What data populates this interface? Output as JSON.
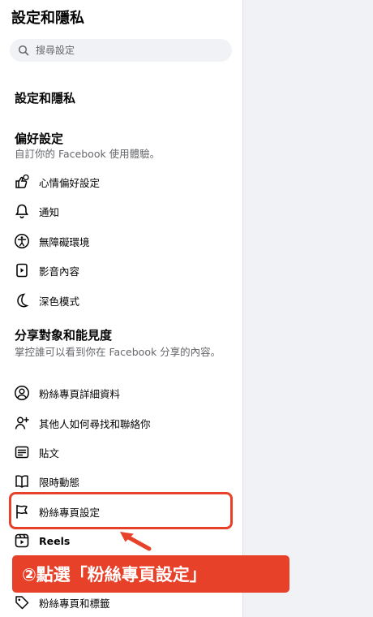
{
  "page_title": "設定和隱私",
  "search": {
    "placeholder": "搜尋設定"
  },
  "section_heading": "設定和隱私",
  "preferences": {
    "title": "偏好設定",
    "description": "自訂你的 Facebook 使用體驗。",
    "items": [
      {
        "label": "心情偏好設定",
        "icon": "reaction-preferences-icon"
      },
      {
        "label": "通知",
        "icon": "bell-icon"
      },
      {
        "label": "無障礙環境",
        "icon": "accessibility-icon"
      },
      {
        "label": "影音內容",
        "icon": "media-play-icon"
      },
      {
        "label": "深色模式",
        "icon": "moon-icon"
      }
    ]
  },
  "audience": {
    "title": "分享對象和能見度",
    "description": "掌控誰可以看到你在 Facebook 分享的內容。",
    "items": [
      {
        "label": "粉絲專頁詳細資料",
        "icon": "profile-circle-icon"
      },
      {
        "label": "其他人如何尋找和聯絡你",
        "icon": "person-add-icon"
      },
      {
        "label": "貼文",
        "icon": "post-icon"
      },
      {
        "label": "限時動態",
        "icon": "book-icon"
      },
      {
        "label": "粉絲專頁設定",
        "icon": "flag-icon"
      },
      {
        "label": "Reels",
        "icon": "reels-icon"
      },
      {
        "label": "粉絲專頁和標籤",
        "icon": "tag-icon"
      }
    ]
  },
  "annotation": {
    "callout": "②點選「粉絲專頁設定」",
    "color": "#e8412a"
  }
}
